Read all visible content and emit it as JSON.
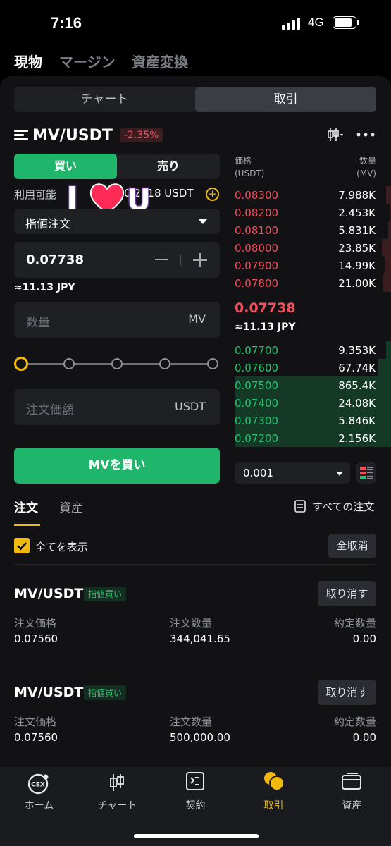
{
  "status": {
    "time": "7:16",
    "network": "4G"
  },
  "top_tabs": [
    {
      "label": "現物",
      "active": true
    },
    {
      "label": "マージン",
      "active": false
    },
    {
      "label": "資産変換",
      "active": false
    }
  ],
  "segment": {
    "chart": "チャート",
    "trade": "取引",
    "active": "取引"
  },
  "pair": {
    "name": "MV/USDT",
    "change": "-2.35%"
  },
  "side": {
    "buy": "買い",
    "sell": "売り",
    "active": "買い"
  },
  "available": {
    "label": "利用可能",
    "value": "0.2318 USDT"
  },
  "sticker_text": "I ❤ U",
  "order_type": "指値注文",
  "price_input": {
    "value": "0.07738",
    "approx": "≈11.13 JPY"
  },
  "quantity_input": {
    "placeholder": "数量",
    "unit": "MV"
  },
  "slider": {
    "percent": 0
  },
  "total_input": {
    "placeholder": "注文価額",
    "unit": "USDT"
  },
  "buy_button": "MVを買い",
  "orderbook": {
    "price_header": "価格",
    "price_unit": "(USDT)",
    "amount_header": "数量",
    "amount_unit": "(MV)",
    "asks": [
      {
        "price": "0.08300",
        "amount": "7.988K",
        "depth": 0.03
      },
      {
        "price": "0.08200",
        "amount": "2.453K",
        "depth": 0.01
      },
      {
        "price": "0.08100",
        "amount": "5.831K",
        "depth": 0.02
      },
      {
        "price": "0.08000",
        "amount": "23.85K",
        "depth": 0.06
      },
      {
        "price": "0.07900",
        "amount": "14.99K",
        "depth": 0.04
      },
      {
        "price": "0.07800",
        "amount": "21.00K",
        "depth": 0.05
      }
    ],
    "mid_price": "0.07738",
    "mid_approx": "≈11.13 JPY",
    "bids": [
      {
        "price": "0.07700",
        "amount": "9.353K",
        "depth": 0.03
      },
      {
        "price": "0.07600",
        "amount": "67.74K",
        "depth": 0.08
      },
      {
        "price": "0.07500",
        "amount": "865.4K",
        "depth": 1.0
      },
      {
        "price": "0.07400",
        "amount": "24.08K",
        "depth": 1.0
      },
      {
        "price": "0.07300",
        "amount": "5.846K",
        "depth": 1.0
      },
      {
        "price": "0.07200",
        "amount": "2.156K",
        "depth": 1.0
      }
    ],
    "precision": "0.001"
  },
  "orders_section": {
    "tabs": [
      {
        "label": "注文",
        "active": true
      },
      {
        "label": "資産",
        "active": false
      }
    ],
    "all_orders": "すべての注文",
    "show_all": "全てを表示",
    "cancel_all": "全取消",
    "col_price": "注文価格",
    "col_qty": "注文数量",
    "col_filled": "約定数量",
    "orders": [
      {
        "pair": "MV/USDT",
        "tag": "指値買い",
        "cancel": "取り消す",
        "price": "0.07560",
        "qty": "344,041.65",
        "filled": "0.00"
      },
      {
        "pair": "MV/USDT",
        "tag": "指値買い",
        "cancel": "取り消す",
        "price": "0.07560",
        "qty": "500,000.00",
        "filled": "0.00"
      }
    ]
  },
  "bottom_nav": [
    {
      "label": "ホーム",
      "icon": "cex-logo-icon",
      "active": false
    },
    {
      "label": "チャート",
      "icon": "candlestick-icon",
      "active": false
    },
    {
      "label": "契約",
      "icon": "contract-icon",
      "active": false
    },
    {
      "label": "取引",
      "icon": "trade-coins-icon",
      "active": true
    },
    {
      "label": "資産",
      "icon": "wallet-icon",
      "active": false
    }
  ],
  "colors": {
    "buy_green": "#1fb66b",
    "sell_red": "#f0505b",
    "accent_yellow": "#f0b90b"
  }
}
